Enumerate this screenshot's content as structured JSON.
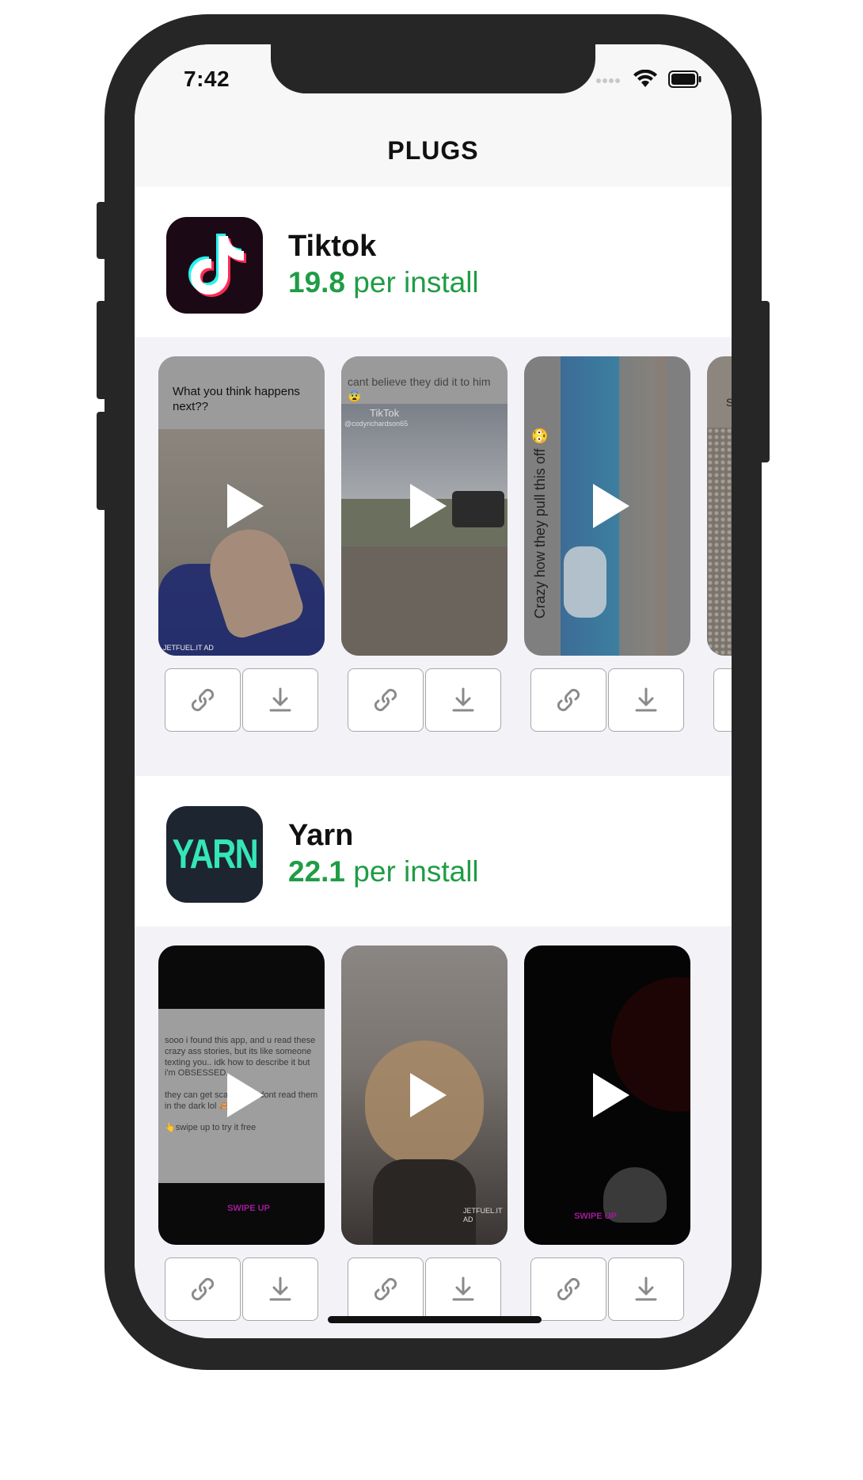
{
  "status_bar": {
    "time": "7:42"
  },
  "nav": {
    "title": "PLUGS"
  },
  "apps": [
    {
      "name": "Tiktok",
      "rate_value": "19.8",
      "rate_suffix": " per install",
      "icon": "tiktok-logo-icon",
      "videos": [
        {
          "caption": "What you think happens next??",
          "watermark": "JETFUEL.IT AD"
        },
        {
          "caption": "cant believe they did it to him 😨",
          "overlay": "TikTok",
          "handle": "@codyrichardson65"
        },
        {
          "caption": "Crazy how they pull this off 😳"
        },
        {
          "caption": "S"
        }
      ]
    },
    {
      "name": "Yarn",
      "rate_value": "22.1",
      "rate_suffix": " per install",
      "icon": "yarn-logo-icon",
      "icon_text": "YARN",
      "videos": [
        {
          "caption": "sooo i found this app, and u read these crazy ass stories, but its like someone texting you.. idk how to describe it but i'm OBSESSED.\n\nthey can get scary af so dont read them in the dark lol 🙈\n\n👆swipe up to try it free",
          "badge": "SWIPE UP"
        },
        {
          "watermark": "JETFUEL.IT AD"
        },
        {
          "badge": "SWIPE UP"
        }
      ]
    }
  ],
  "actions": {
    "link_icon": "link-icon",
    "download_icon": "download-icon"
  },
  "colors": {
    "rate_green": "#1f9d45",
    "strip_bg": "#f2f2f7",
    "tiktok_bg": "#1b0a16",
    "yarn_bg": "#1c2530",
    "yarn_text": "#35e6b8"
  }
}
